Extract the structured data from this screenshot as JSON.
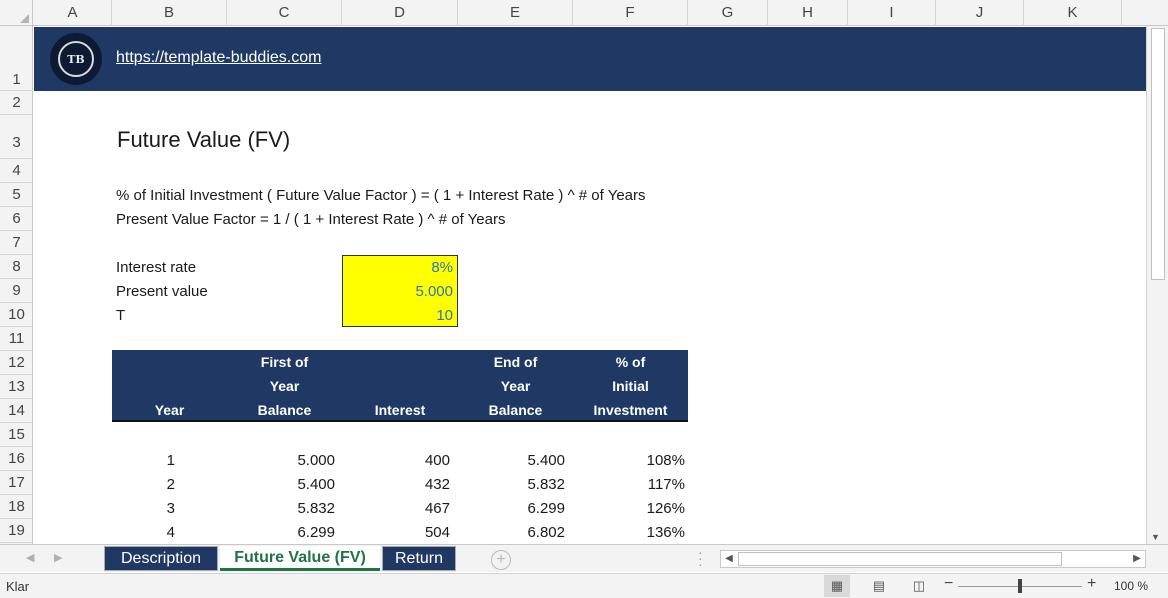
{
  "columns": [
    "A",
    "B",
    "C",
    "D",
    "E",
    "F",
    "G",
    "H",
    "I",
    "J",
    "K"
  ],
  "rows": [
    "1",
    "2",
    "3",
    "4",
    "5",
    "6",
    "7",
    "8",
    "9",
    "10",
    "11",
    "12",
    "13",
    "14",
    "15",
    "16",
    "17",
    "18",
    "19"
  ],
  "banner": {
    "logo_text": "TB",
    "link": "https://template-buddies.com"
  },
  "title": "Future Value (FV)",
  "formulas": [
    "% of Initial Investment ( Future Value Factor )  =  ( 1 + Interest Rate ) ^ # of Years",
    "Present Value Factor  = 1 / ( 1 + Interest Rate ) ^ # of Years"
  ],
  "inputs": {
    "labels": [
      "Interest rate",
      "Present value",
      "T"
    ],
    "values": [
      "8%",
      "5.000",
      "10"
    ]
  },
  "table": {
    "headers": [
      [
        "",
        "",
        "Year"
      ],
      [
        "First of",
        "Year",
        "Balance"
      ],
      [
        "",
        "",
        "Interest"
      ],
      [
        "End of",
        "Year",
        "Balance"
      ],
      [
        "% of",
        "Initial",
        "Investment"
      ]
    ],
    "rows": [
      [
        "1",
        "5.000",
        "400",
        "5.400",
        "108%"
      ],
      [
        "2",
        "5.400",
        "432",
        "5.832",
        "117%"
      ],
      [
        "3",
        "5.832",
        "467",
        "6.299",
        "126%"
      ],
      [
        "4",
        "6.299",
        "504",
        "6.802",
        "136%"
      ]
    ]
  },
  "sheet_tabs": [
    {
      "label": "Description",
      "active": false
    },
    {
      "label": "Future Value (FV)",
      "active": true
    },
    {
      "label": "Return",
      "active": false
    }
  ],
  "status": {
    "text": "Klar",
    "zoom": "100 %"
  },
  "colors": {
    "banner": "#1f3864",
    "input_fill": "#ffff00",
    "input_text": "#2e75b6",
    "active_tab": "#217346"
  }
}
